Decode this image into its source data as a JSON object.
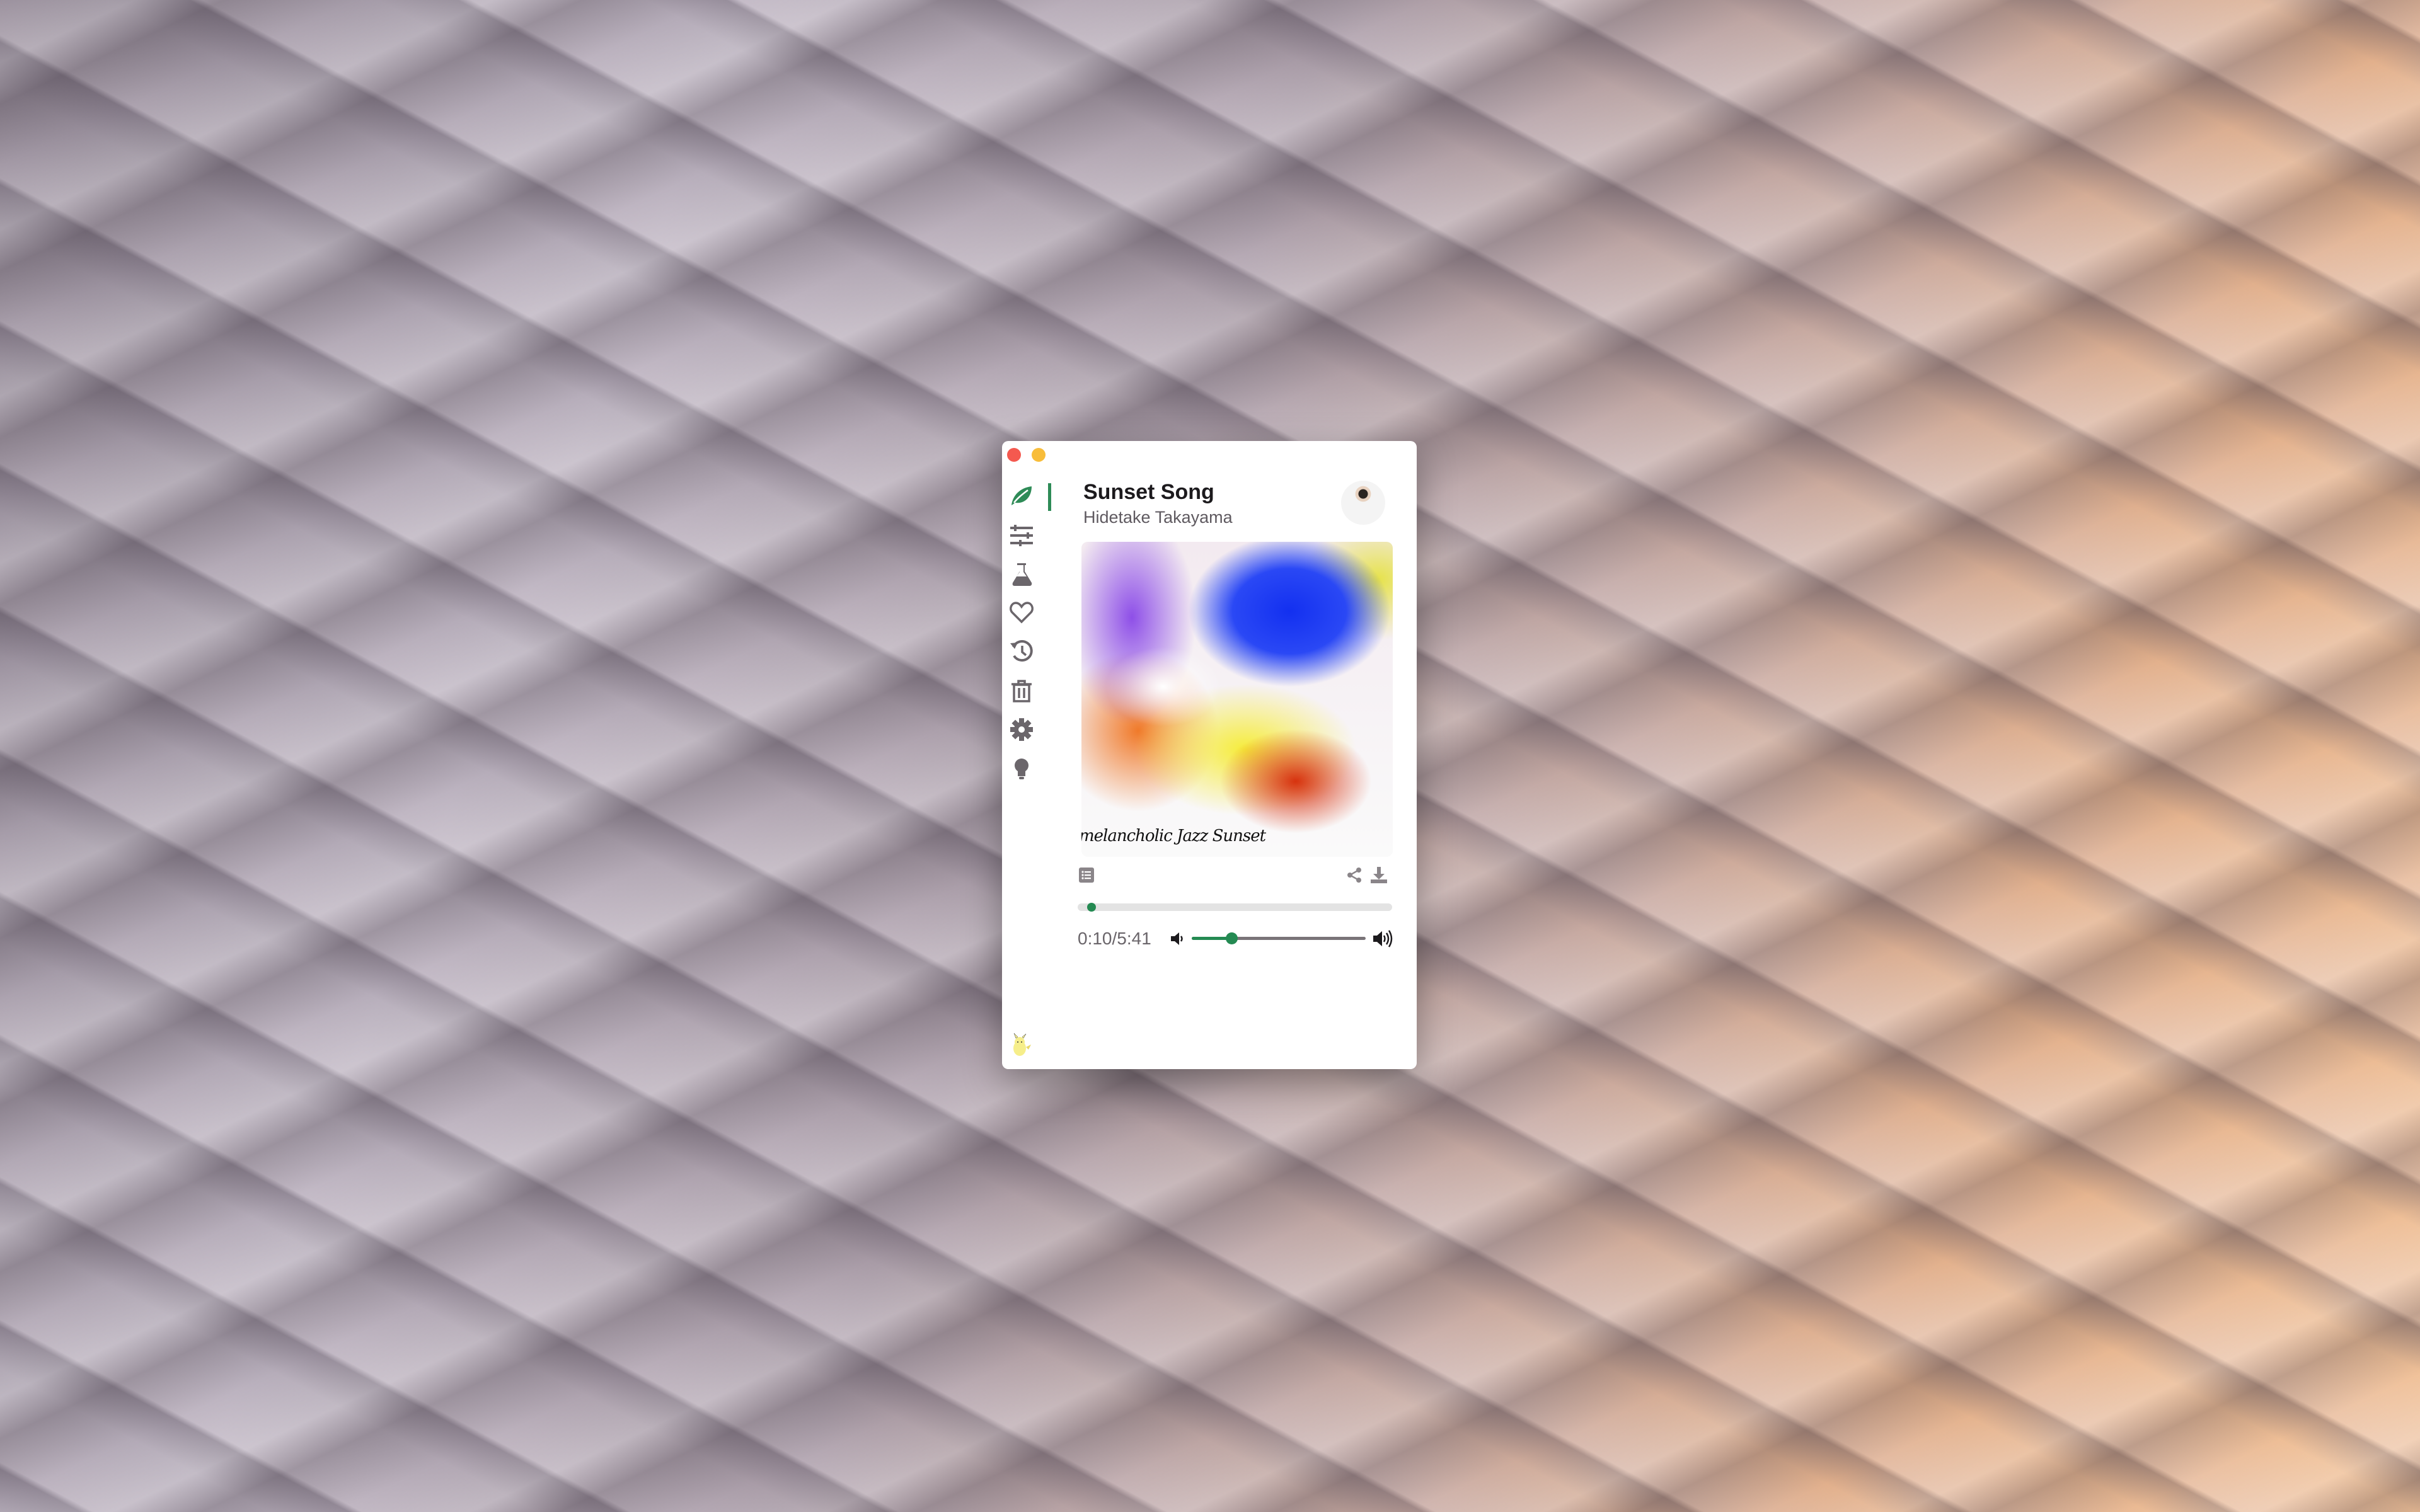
{
  "window": {
    "controls": [
      "close",
      "minimize"
    ]
  },
  "sidebar": {
    "items": [
      {
        "name": "leaf",
        "active": true
      },
      {
        "name": "sliders"
      },
      {
        "name": "flask"
      },
      {
        "name": "heart"
      },
      {
        "name": "history"
      },
      {
        "name": "trash"
      },
      {
        "name": "gear"
      },
      {
        "name": "lightbulb"
      }
    ],
    "accent": "#2e8b57"
  },
  "track": {
    "title": "Sunset Song",
    "artist": "Hidetake Takayama",
    "album_art_caption": "melancholic Jazz Sunset",
    "time_display": "0:10/5:41",
    "progress_fraction": 0.03
  },
  "volume": {
    "level": 0.23
  },
  "colors": {
    "accent": "#248a52",
    "icon": "#6b666b",
    "track": "#7a7478"
  }
}
